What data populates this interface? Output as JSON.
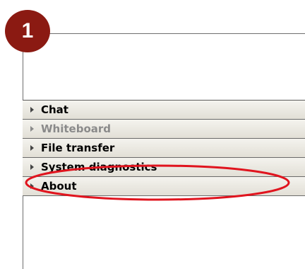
{
  "badge": {
    "number": "1",
    "color": "#8b1a12"
  },
  "accordion": {
    "items": [
      {
        "label": "Chat",
        "enabled": true
      },
      {
        "label": "Whiteboard",
        "enabled": false
      },
      {
        "label": "File transfer",
        "enabled": true
      },
      {
        "label": "System diagnostics",
        "enabled": true,
        "highlighted": true
      },
      {
        "label": "About",
        "enabled": true
      }
    ]
  },
  "highlight_color": "#e0141e"
}
